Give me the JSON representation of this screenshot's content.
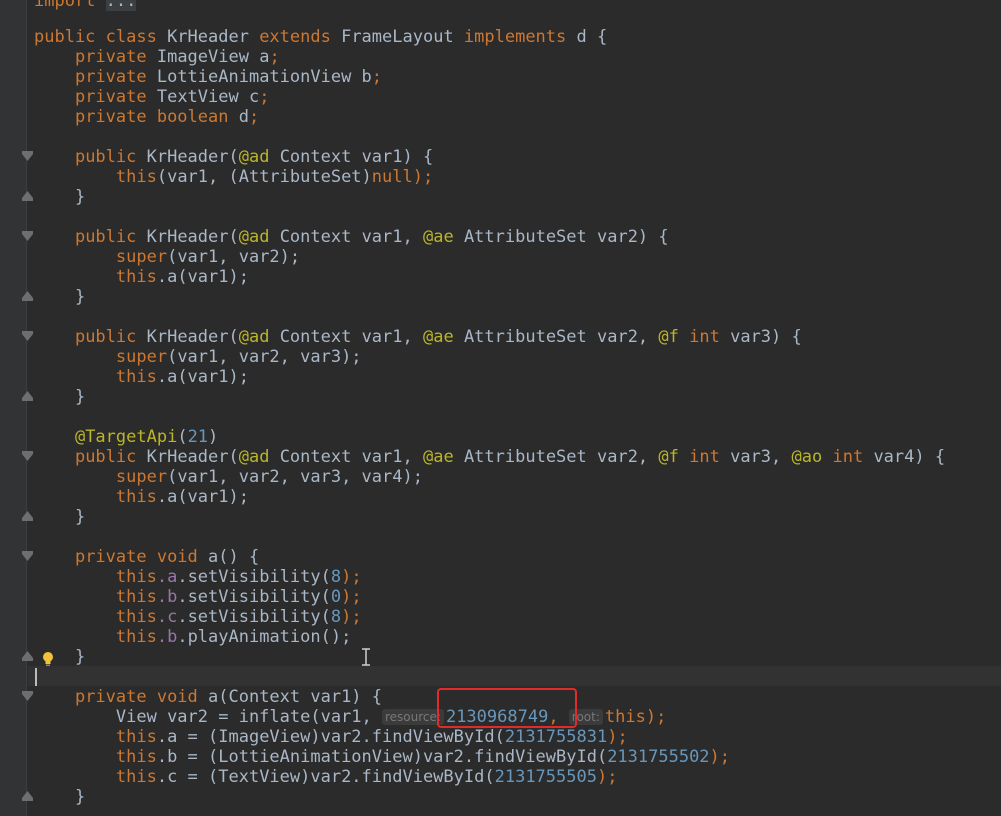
{
  "editor": {
    "import_line": {
      "keyword": "import",
      "ellipsis": "..."
    },
    "class_decl": {
      "kw1": "public class",
      "name": " KrHeader ",
      "kw2": "extends",
      "base": " FrameLayout ",
      "kw3": "implements",
      "iface": " d {"
    },
    "fields": [
      {
        "mod": "private",
        "type": " ImageView ",
        "name": "a",
        "end": ";"
      },
      {
        "mod": "private",
        "type": " LottieAnimationView ",
        "name": "b",
        "end": ";"
      },
      {
        "mod": "private",
        "type": " TextView ",
        "name": "c",
        "end": ";"
      },
      {
        "mod": "private boolean",
        "type": " ",
        "name": "d",
        "end": ";"
      }
    ],
    "ctor1": {
      "sig_kw": "public",
      "sig": " KrHeader(",
      "ann1": "@ad",
      "rest": " Context var1) {",
      "body_kw": "this",
      "body_a": "(var1, (AttributeSet)",
      "body_null": "null",
      "body_end": ");",
      "close": "}"
    },
    "ctor2": {
      "sig_kw": "public",
      "sig": " KrHeader(",
      "ann1": "@ad",
      "mid": " Context var1, ",
      "ann2": "@ae",
      "rest": " AttributeSet var2) {",
      "b1_kw": "super",
      "b1": "(var1, var2);",
      "b2_kw": "this",
      "b2": ".a(var1);",
      "close": "}"
    },
    "ctor3": {
      "sig_kw": "public",
      "sig": " KrHeader(",
      "ann1": "@ad",
      "mid1": " Context var1, ",
      "ann2": "@ae",
      "mid2": " AttributeSet var2, ",
      "ann3": "@f",
      "sp": " ",
      "int_kw": "int",
      "rest": " var3) {",
      "b1_kw": "super",
      "b1": "(var1, var2, var3);",
      "b2_kw": "this",
      "b2": ".a(var1);",
      "close": "}"
    },
    "ctor4": {
      "annotation": "@TargetApi",
      "ann_open": "(",
      "ann_num": "21",
      "ann_close": ")",
      "sig_kw": "public",
      "sig": " KrHeader(",
      "ann1": "@ad",
      "mid1": " Context var1, ",
      "ann2": "@ae",
      "mid2": " AttributeSet var2, ",
      "ann3": "@f",
      "sp": " ",
      "int_kw": "int",
      "mid3": " var3, ",
      "ann4": "@ao",
      "int_kw2": "int",
      "rest": " var4) {",
      "b1_kw": "super",
      "b1": "(var1, var2, var3, var4);",
      "b2_kw": "this",
      "b2": ".a(var1);",
      "close": "}"
    },
    "method_a": {
      "sig_kw": "private void",
      "sig": " a() {",
      "lines": [
        {
          "kw": "this",
          "field": ".a",
          "call": ".setVisibility(",
          "num": "8",
          "end": ");"
        },
        {
          "kw": "this",
          "field": ".b",
          "call": ".setVisibility(",
          "num": "0",
          "end": ");"
        },
        {
          "kw": "this",
          "field": ".c",
          "call": ".setVisibility(",
          "num": "8",
          "end": ");"
        },
        {
          "kw": "this",
          "field": ".b",
          "call": ".playAnimation();",
          "num": "",
          "end": ""
        }
      ],
      "close": "}"
    },
    "method_a_ctx": {
      "sig_kw": "private void",
      "sig": " a(Context var1) {",
      "inflate": {
        "pre": "View var2 = inflate(var1, ",
        "hint1": "resource:",
        "num": "2130968749",
        "comma": ", ",
        "hint2": "root:",
        "kw": "this",
        "end": ");"
      },
      "finds": [
        {
          "kw": "this",
          "pre": ".a = (ImageView)var2.findViewById(",
          "num": "2131755831",
          "end": ");"
        },
        {
          "kw": "this",
          "pre": ".b = (LottieAnimationView)var2.findViewById(",
          "num": "2131755502",
          "end": ");"
        },
        {
          "kw": "this",
          "pre": ".c = (TextView)var2.findViewById(",
          "num": "2131755505",
          "end": ");"
        }
      ],
      "close": "}"
    }
  },
  "colors": {
    "background": "#2b2b2b",
    "keyword": "#cc7832",
    "number": "#6897bb",
    "plain": "#a9b7c6",
    "annotation": "#bbb529",
    "highlight_box": "#e02b2b"
  },
  "icons": {
    "gutter_fold": "fold-marker-icon",
    "intention": "lightbulb-icon",
    "cursor": "text-cursor-icon"
  }
}
